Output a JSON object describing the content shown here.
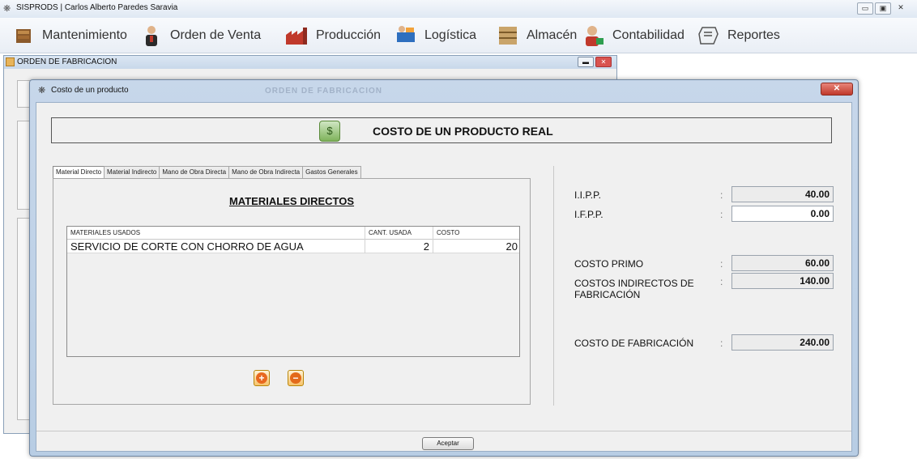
{
  "app": {
    "title": "SISPRODS | Carlos Alberto Paredes Saravia",
    "minimize": "▭",
    "maximize": "▣",
    "close": "✕"
  },
  "menu": [
    {
      "label": "Mantenimiento",
      "icon": "books-icon"
    },
    {
      "label": "Orden de Venta",
      "icon": "salesperson-icon"
    },
    {
      "label": "Producción",
      "icon": "factory-icon"
    },
    {
      "label": "Logística",
      "icon": "logistics-icon"
    },
    {
      "label": "Almacén",
      "icon": "warehouse-icon"
    },
    {
      "label": "Contabilidad",
      "icon": "accountant-icon"
    },
    {
      "label": "Reportes",
      "icon": "reports-icon"
    }
  ],
  "bg_window": {
    "title": "ORDEN DE FABRICACION"
  },
  "dialog": {
    "title": "Costo de un producto",
    "behind_title": "ORDEN DE FABRICACION",
    "header": "COSTO DE UN PRODUCTO REAL",
    "tabs": [
      "Material Directo",
      "Material Indirecto",
      "Mano de Obra Directa",
      "Mano de Obra Indirecta",
      "Gastos Generales"
    ],
    "active_tab": 0,
    "panel_title": "MATERIALES DIRECTOS",
    "table": {
      "columns": [
        "MATERIALES USADOS",
        "CANT. USADA",
        "COSTO"
      ],
      "rows": [
        [
          "SERVICIO DE CORTE CON CHORRO DE AGUA",
          "2",
          "20"
        ]
      ]
    },
    "add_button": "+",
    "remove_button": "−",
    "fields": {
      "iipp": {
        "label": "I.I.P.P.",
        "value": "40.00"
      },
      "ifpp": {
        "label": "I.F.P.P.",
        "value": "0.00"
      },
      "costo_primo": {
        "label": "COSTO PRIMO",
        "value": "60.00"
      },
      "cif": {
        "label": "COSTOS INDIRECTOS DE FABRICACIÓN",
        "value": "140.00"
      },
      "costo_fab": {
        "label": "COSTO DE FABRICACIÓN",
        "value": "240.00"
      }
    },
    "colon": ":",
    "accept": "Aceptar"
  }
}
